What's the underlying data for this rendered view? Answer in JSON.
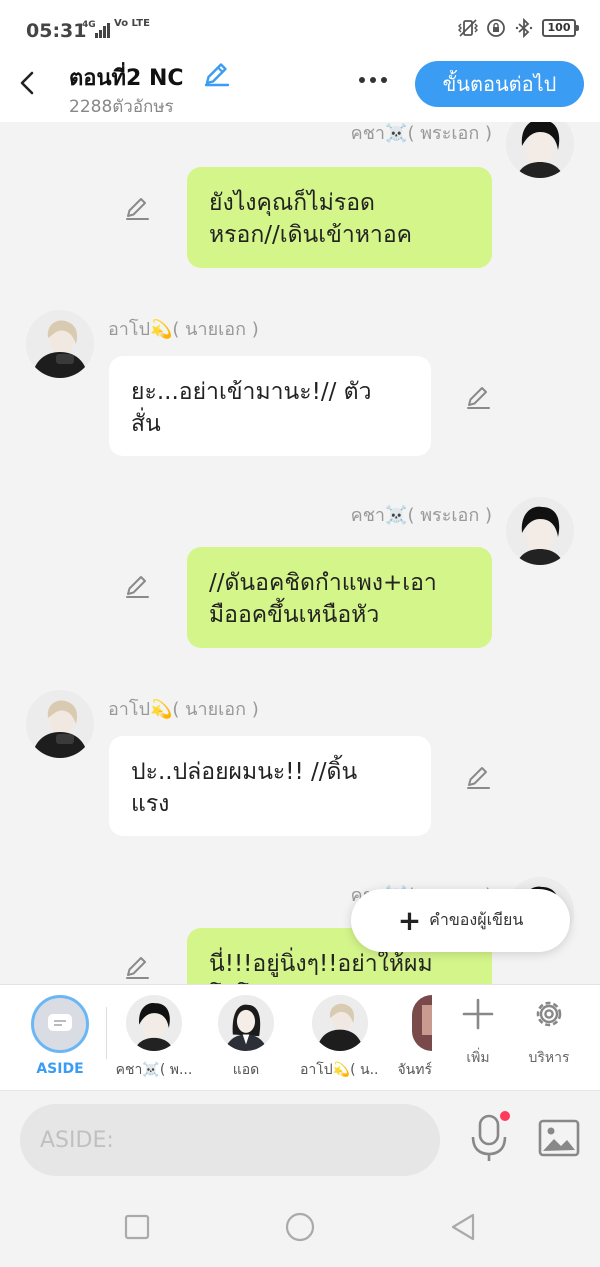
{
  "status": {
    "time": "05:31",
    "network": "4G",
    "volte": "Vo LTE",
    "battery": "100"
  },
  "header": {
    "title": "ตอนที่2 NC",
    "char_count": "2288ตัวอักษร",
    "next_label": "ขั้นตอนต่อไป"
  },
  "messages": [
    {
      "side": "right",
      "sender": "คชา☠️( พระเอก )",
      "text": "ยังไงคุณก็ไม่รอด\nหรอก//เดินเข้าหาอค"
    },
    {
      "side": "left",
      "sender": "อาโป💫( นายเอก )",
      "text": "ยะ...อย่าเข้ามานะ!// ตัว\nสั่น"
    },
    {
      "side": "right",
      "sender": "คชา☠️( พระเอก )",
      "text": "//ดันอคชิดกำแพง+เอา\nมืออคขึ้นเหนือหัว"
    },
    {
      "side": "left",
      "sender": "อาโป💫( นายเอก )",
      "text": "ปะ..ปล่อยผมนะ!! //ดิ้น\nแรง"
    },
    {
      "side": "right",
      "sender": "คชา☠️( พระเอก )",
      "text": "นี่!!!อยู่นิ่งๆ!!อย่าให้ผม\nโมโห"
    }
  ],
  "writer_pill": {
    "label": "คำของผู้เขียน"
  },
  "characters": {
    "aside_label": "ASIDE",
    "items": [
      {
        "name": "คชา☠️( พ...",
        "icon": "avatar-dark-hair-man"
      },
      {
        "name": "แอด",
        "icon": "avatar-woman-suit"
      },
      {
        "name": "อาโป💫( น...",
        "icon": "avatar-blonde-man"
      },
      {
        "name": "จันทร์",
        "icon": "avatar-partial"
      }
    ],
    "add_label": "เพิ่ม",
    "manage_label": "บริหาร"
  },
  "input": {
    "placeholder": "ASIDE:"
  },
  "colors": {
    "accent": "#3a9cf2",
    "bubble_right": "#d4f58a",
    "bubble_left": "#ffffff",
    "background": "#f3f3f3",
    "mic_dot": "#ff3b5c"
  }
}
